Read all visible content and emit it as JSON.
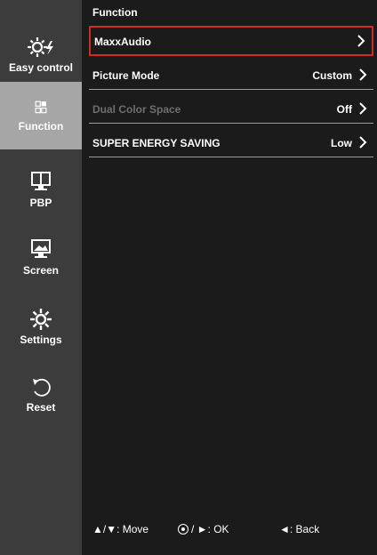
{
  "sidebar": {
    "items": [
      {
        "label": "Easy control",
        "icon": "easy-control-icon",
        "active": false
      },
      {
        "label": "Function",
        "icon": "function-icon",
        "active": true
      },
      {
        "label": "PBP",
        "icon": "pbp-icon",
        "active": false
      },
      {
        "label": "Screen",
        "icon": "screen-icon",
        "active": false
      },
      {
        "label": "Settings",
        "icon": "settings-icon",
        "active": false
      },
      {
        "label": "Reset",
        "icon": "reset-icon",
        "active": false
      }
    ]
  },
  "main": {
    "title": "Function",
    "rows": [
      {
        "label": "MaxxAudio",
        "value": "",
        "selected": true,
        "disabled": false
      },
      {
        "label": "Picture Mode",
        "value": "Custom",
        "selected": false,
        "disabled": false
      },
      {
        "label": "Dual Color Space",
        "value": "Off",
        "selected": false,
        "disabled": true
      },
      {
        "label": "SUPER ENERGY SAVING",
        "value": "Low",
        "selected": false,
        "disabled": false
      }
    ]
  },
  "footer": {
    "move": "▲/▼: Move",
    "ok": "/ ►: OK",
    "back": "◄: Back"
  },
  "colors": {
    "selection_border": "#d02a2a",
    "active_sidebar": "#a6a6a6",
    "sidebar_bg": "#3c3c3c",
    "main_bg": "#1b1b1b"
  }
}
